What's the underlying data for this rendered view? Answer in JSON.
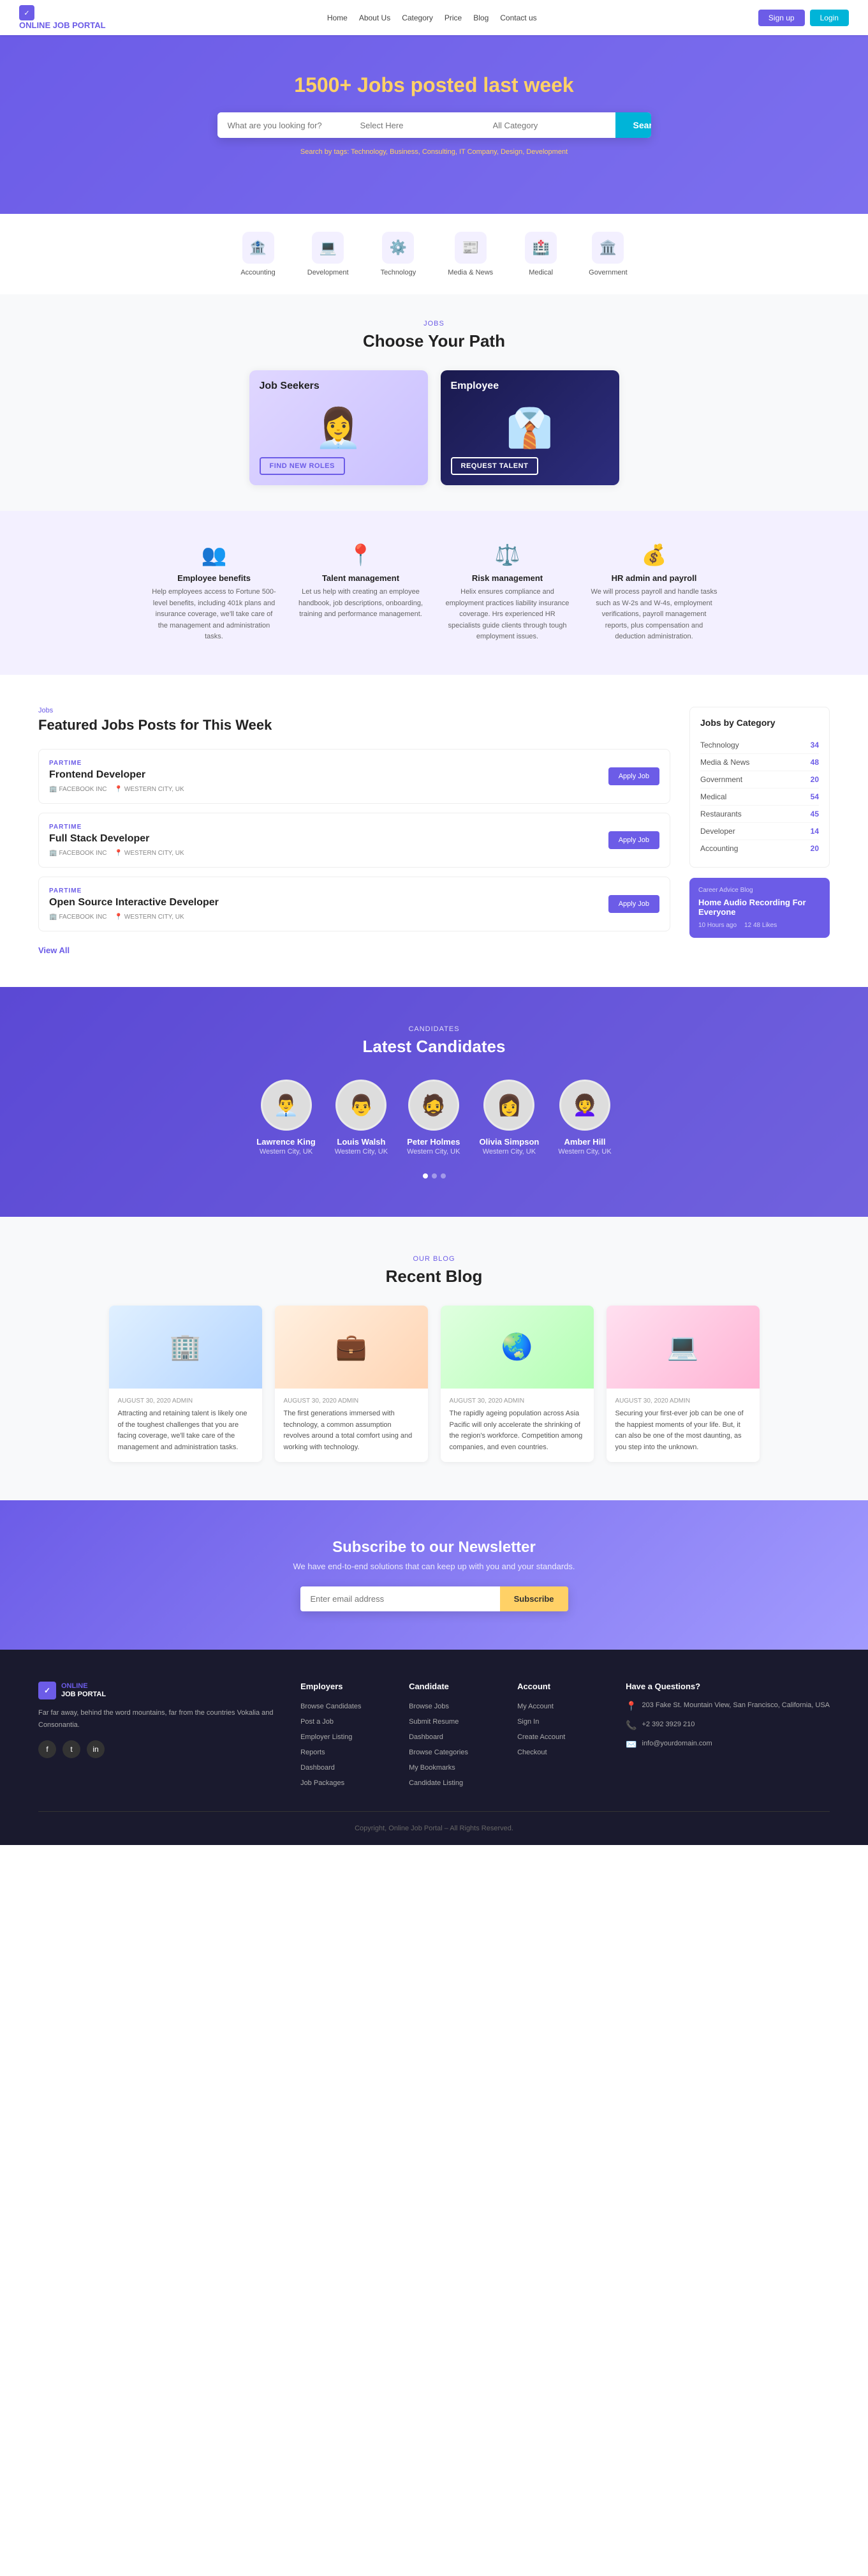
{
  "nav": {
    "logo_text": "ONLINE JOB PORTAL",
    "links": [
      "Home",
      "About Us",
      "Category",
      "Price",
      "Blog",
      "Contact us"
    ],
    "btn_signup": "Sign up",
    "btn_login": "Login"
  },
  "hero": {
    "headline_highlight": "1500+",
    "headline_rest": " Jobs posted last week",
    "search_placeholder1": "What are you looking for?",
    "search_placeholder2": "Select Here",
    "search_placeholder3": "All Category",
    "search_btn": "Search",
    "tags_label": "Search by tags:",
    "tags": "Technology, Business, Consulting, IT Company, Design, Development"
  },
  "categories": {
    "items": [
      {
        "icon": "🏦",
        "label": "Accounting"
      },
      {
        "icon": "💻",
        "label": "Development"
      },
      {
        "icon": "⚙️",
        "label": "Technology"
      },
      {
        "icon": "📰",
        "label": "Media & News"
      },
      {
        "icon": "🏥",
        "label": "Medical"
      },
      {
        "icon": "🏛️",
        "label": "Government"
      }
    ]
  },
  "choose_path": {
    "tag": "Jobs",
    "title": "Choose Your Path",
    "cards": [
      {
        "label": "Job Seekers",
        "btn": "FIND NEW ROLES"
      },
      {
        "label": "Employee",
        "btn": "REQUEST TALENT"
      }
    ]
  },
  "features": {
    "items": [
      {
        "icon": "👥",
        "title": "Employee benefits",
        "desc": "Help employees access to Fortune 500-level benefits, including 401k plans and insurance coverage, we'll take care of the management and administration tasks."
      },
      {
        "icon": "📍",
        "title": "Talent management",
        "desc": "Let us help with creating an employee handbook, job descriptions, onboarding, training and performance management."
      },
      {
        "icon": "⚖️",
        "title": "Risk management",
        "desc": "Helix ensures compliance and employment practices liability insurance coverage. Hrs experienced HR specialists guide clients through tough employment issues."
      },
      {
        "icon": "💰",
        "title": "HR admin and payroll",
        "desc": "We will process payroll and handle tasks such as W-2s and W-4s, employment verifications, payroll management reports, plus compensation and deduction administration."
      }
    ]
  },
  "featured_jobs": {
    "tag": "Jobs",
    "title": "Featured Jobs Posts for This Week",
    "jobs": [
      {
        "type": "PARTIME",
        "title": "Frontend Developer",
        "company": "FACEBOOK INC",
        "location": "WESTERN CITY, UK"
      },
      {
        "type": "PARTIME",
        "title": "Full Stack Developer",
        "company": "FACEBOOK INC",
        "location": "WESTERN CITY, UK"
      },
      {
        "type": "PARTIME",
        "title": "Open Source Interactive Developer",
        "company": "FACEBOOK INC",
        "location": "WESTERN CITY, UK"
      }
    ],
    "apply_btn": "Apply Job",
    "view_all": "View All",
    "sidebar": {
      "title": "Jobs by Category",
      "categories": [
        {
          "name": "Technology",
          "count": "34"
        },
        {
          "name": "Media & News",
          "count": "48"
        },
        {
          "name": "Government",
          "count": "20"
        },
        {
          "name": "Medical",
          "count": "54"
        },
        {
          "name": "Restaurants",
          "count": "45"
        },
        {
          "name": "Developer",
          "count": "14"
        },
        {
          "name": "Accounting",
          "count": "20"
        }
      ],
      "blog": {
        "tag": "Career Advice Blog",
        "title": "Home Audio Recording For Everyone",
        "time_ago": "10 Hours ago",
        "likes": "12 48 Likes"
      }
    }
  },
  "candidates": {
    "tag": "Candidates",
    "title": "Latest Candidates",
    "items": [
      {
        "name": "Lawrence King",
        "location": "Western City, UK",
        "avatar": "👨‍💼"
      },
      {
        "name": "Louis Walsh",
        "location": "Western City, UK",
        "avatar": "👨"
      },
      {
        "name": "Peter Holmes",
        "location": "Western City, UK",
        "avatar": "🧔"
      },
      {
        "name": "Olivia Simpson",
        "location": "Western City, UK",
        "avatar": "👩"
      },
      {
        "name": "Amber Hill",
        "location": "Western City, UK",
        "avatar": "👩‍🦱"
      }
    ]
  },
  "blog": {
    "tag": "Our Blog",
    "title": "Recent Blog",
    "posts": [
      {
        "date": "AUGUST 30, 2020 ADMIN",
        "excerpt": "Attracting and retaining talent is likely one of the toughest challenges that you are facing coverage, we'll take care of the management and administration tasks."
      },
      {
        "date": "AUGUST 30, 2020 ADMIN",
        "excerpt": "The first generations immersed with technology, a common assumption revolves around a total comfort using and working with technology."
      },
      {
        "date": "AUGUST 30, 2020 ADMIN",
        "excerpt": "The rapidly ageing population across Asia Pacific will only accelerate the shrinking of the region's workforce. Competition among companies, and even countries."
      },
      {
        "date": "AUGUST 30, 2020 ADMIN",
        "excerpt": "Securing your first-ever job can be one of the happiest moments of your life. But, it can also be one of the most daunting, as you step into the unknown."
      }
    ]
  },
  "newsletter": {
    "title": "Subscribe to our Newsletter",
    "desc": "We have end-to-end solutions that can keep up with you and your standards.",
    "placeholder": "Enter email address",
    "btn": "Subscribe"
  },
  "footer": {
    "logo": "ONLINE JOB PORTAL",
    "brand_desc": "Far far away, behind the word mountains, far from the countries Vokalia and Consonantia.",
    "columns": [
      {
        "title": "Employers",
        "links": [
          "Browse Candidates",
          "Post a Job",
          "Employer Listing",
          "Reports",
          "Dashboard",
          "Job Packages"
        ]
      },
      {
        "title": "Candidate",
        "links": [
          "Browse Jobs",
          "Submit Resume",
          "Dashboard",
          "Browse Categories",
          "My Bookmarks",
          "Candidate Listing"
        ]
      },
      {
        "title": "Account",
        "links": [
          "My Account",
          "Sign In",
          "Create Account",
          "Checkout"
        ]
      }
    ],
    "contact_title": "Have a Questions?",
    "address": "203 Fake St. Mountain View, San Francisco, California, USA",
    "phone": "+2 392 3929 210",
    "email": "info@yourdomain.com",
    "copyright": "Copyright, Online Job Portal – All Rights Reserved."
  }
}
